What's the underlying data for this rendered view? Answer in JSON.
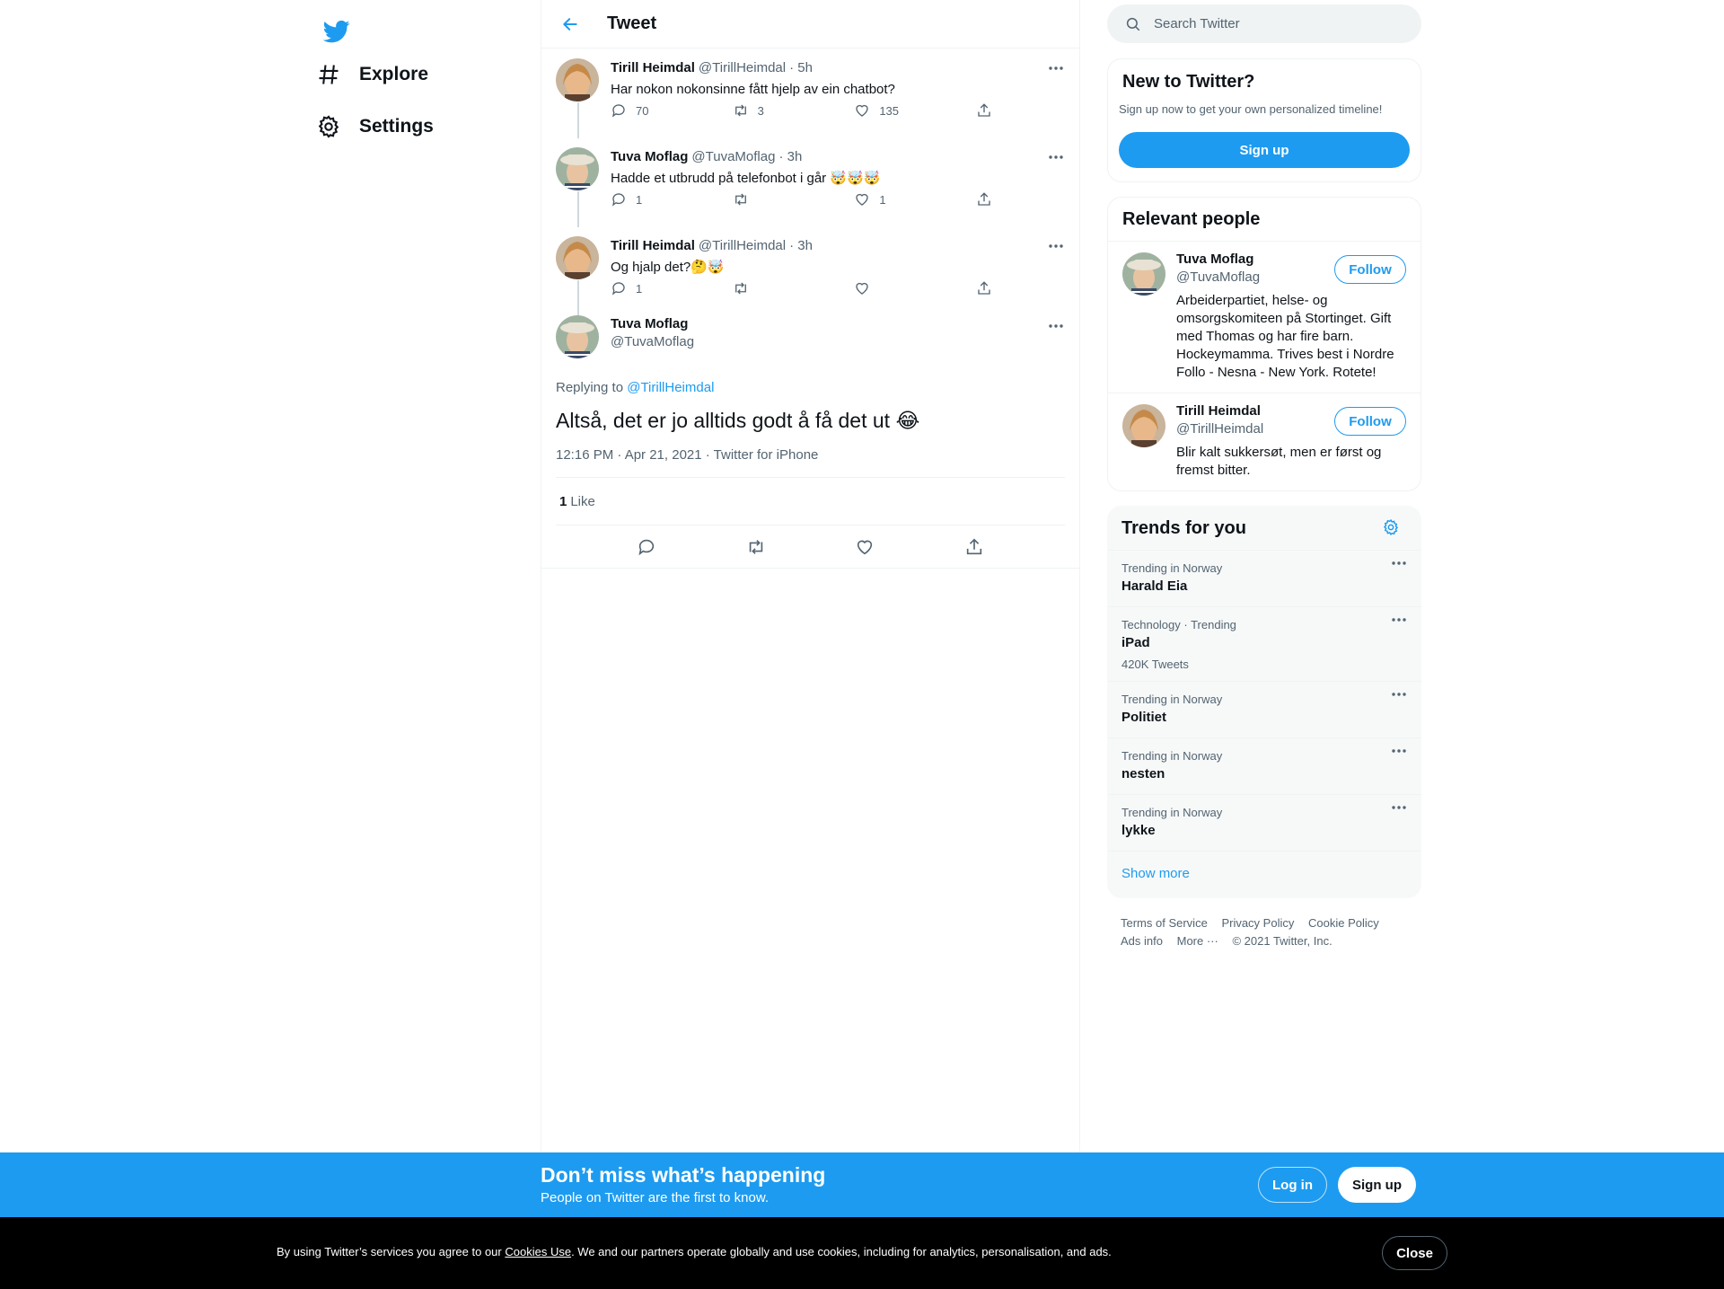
{
  "colors": {
    "accent": "#1d9bf0",
    "text": "#0f1419",
    "muted": "#536471",
    "border": "#eff3f4"
  },
  "nav": {
    "logo_icon": "twitter-bird-icon",
    "items": [
      {
        "label": "Explore",
        "icon": "hashtag-icon"
      },
      {
        "label": "Settings",
        "icon": "gear-icon"
      }
    ]
  },
  "header": {
    "title": "Tweet",
    "back_icon": "arrow-left-icon"
  },
  "thread": [
    {
      "name": "Tirill Heimdal",
      "handle": "@TirillHeimdal",
      "time": "· 5h",
      "text": "Har nokon nokonsinne fått hjelp av ein chatbot?",
      "replies": "70",
      "retweets": "3",
      "likes": "135"
    },
    {
      "name": "Tuva Moflag",
      "handle": "@TuvaMoflag",
      "time": "· 3h",
      "text": "Hadde et utbrudd på telefonbot i går 🤯🤯🤯",
      "replies": "1",
      "retweets": "",
      "likes": "1"
    },
    {
      "name": "Tirill Heimdal",
      "handle": "@TirillHeimdal",
      "time": "· 3h",
      "text": "Og hjalp det?🤔🤯",
      "replies": "1",
      "retweets": "",
      "likes": ""
    }
  ],
  "focus": {
    "name": "Tuva Moflag",
    "handle": "@TuvaMoflag",
    "replying_prefix": "Replying to",
    "replying_to": "@TirillHeimdal",
    "text": "Altså, det er jo alltids godt å få det ut 😂",
    "meta": "12:16 PM · Apr 21, 2021 · Twitter for iPhone",
    "like_count": "1",
    "like_label": "Like"
  },
  "search": {
    "placeholder": "Search Twitter"
  },
  "new_to_twitter": {
    "title": "New to Twitter?",
    "subtitle": "Sign up now to get your own personalized timeline!",
    "button": "Sign up"
  },
  "relevant_people": {
    "title": "Relevant people",
    "people": [
      {
        "name": "Tuva Moflag",
        "handle": "@TuvaMoflag",
        "bio": "Arbeiderpartiet, helse- og omsorgskomiteen på Stortinget. Gift med Thomas og har fire barn. Hockeymamma. Trives best i Nordre Follo - Nesna - New York. Rotete!",
        "button": "Follow"
      },
      {
        "name": "Tirill Heimdal",
        "handle": "@TirillHeimdal",
        "bio": "Blir kalt sukkersøt, men er først og fremst bitter.",
        "button": "Follow"
      }
    ]
  },
  "trends": {
    "title": "Trends for you",
    "items": [
      {
        "context": "Trending in Norway",
        "topic": "Harald Eia",
        "count": ""
      },
      {
        "context": "Technology · Trending",
        "topic": "iPad",
        "count": "420K Tweets"
      },
      {
        "context": "Trending in Norway",
        "topic": "Politiet",
        "count": ""
      },
      {
        "context": "Trending in Norway",
        "topic": "nesten",
        "count": ""
      },
      {
        "context": "Trending in Norway",
        "topic": "lykke",
        "count": ""
      }
    ],
    "show_more": "Show more"
  },
  "footer": {
    "links": [
      "Terms of Service",
      "Privacy Policy",
      "Cookie Policy",
      "Ads info",
      "More ···"
    ],
    "copyright": "© 2021 Twitter, Inc."
  },
  "promo": {
    "heading": "Don’t miss what’s happening",
    "sub": "People on Twitter are the first to know.",
    "login": "Log in",
    "signup": "Sign up"
  },
  "cookie": {
    "prefix": "By using Twitter’s services you agree to our ",
    "link": "Cookies Use",
    "suffix": ". We and our partners operate globally and use cookies, including for analytics, personalisation, and ads.",
    "close": "Close"
  }
}
